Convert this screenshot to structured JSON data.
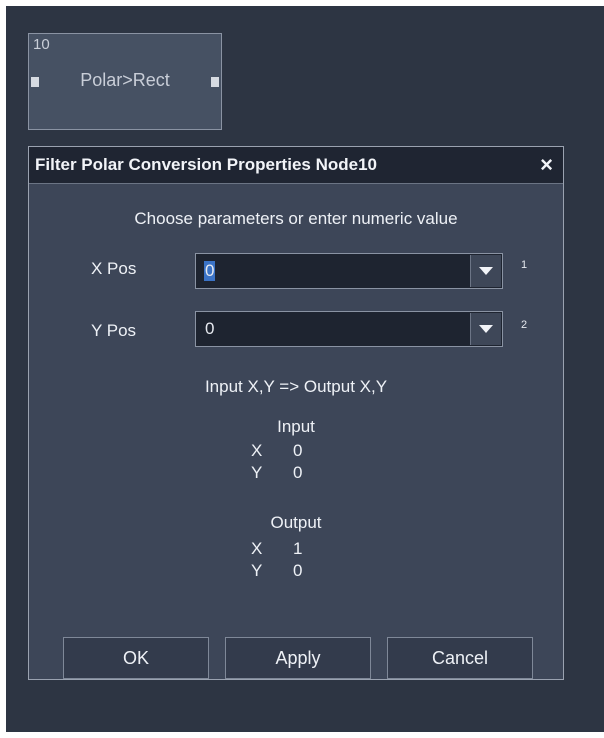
{
  "node": {
    "number": "10",
    "label": "Polar>Rect"
  },
  "dialog": {
    "title": "Filter Polar Conversion Properties Node10",
    "close_glyph": "×",
    "prompt": "Choose parameters or enter numeric value",
    "params": [
      {
        "label": "X Pos",
        "value": "0",
        "index": "1"
      },
      {
        "label": "Y Pos",
        "value": "0",
        "index": "2"
      }
    ],
    "mapping_text": "Input X,Y => Output X,Y",
    "input": {
      "heading": "Input",
      "x_label": "X",
      "x_value": "0",
      "y_label": "Y",
      "y_value": "0"
    },
    "output": {
      "heading": "Output",
      "x_label": "X",
      "x_value": "1",
      "y_label": "Y",
      "y_value": "0"
    },
    "buttons": {
      "ok": "OK",
      "apply": "Apply",
      "cancel": "Cancel"
    }
  },
  "colors": {
    "canvas_bg": "#2d3543",
    "dialog_bg": "#3d4658",
    "titlebar_bg": "#1f2532",
    "selection": "#3b73c6"
  },
  "icons": {
    "close": "close-icon",
    "dropdown": "chevron-down-icon"
  }
}
